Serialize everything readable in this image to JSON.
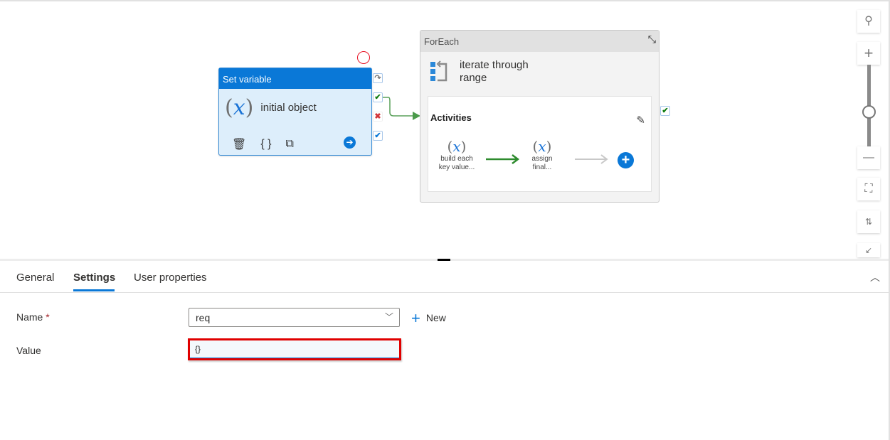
{
  "canvas": {
    "set_variable": {
      "type_label": "Set variable",
      "name": "initial object",
      "actions": [
        "delete-icon",
        "code-icon",
        "copy-icon"
      ],
      "go_icon": "arrow-right-icon"
    },
    "ports": [
      "skip",
      "success",
      "failure",
      "completion"
    ],
    "foreach": {
      "type_label": "ForEach",
      "name_line1": "iterate through",
      "name_line2": "range",
      "activities_label": "Activities",
      "inner": [
        {
          "line1": "build each",
          "line2": "key value..."
        },
        {
          "line1": "assign",
          "line2": "final..."
        }
      ]
    },
    "zoom_level": 0.5
  },
  "panel": {
    "tabs": [
      "General",
      "Settings",
      "User properties"
    ],
    "active_tab": "Settings",
    "name_label": "Name",
    "required_mark": "*",
    "name_value": "req",
    "new_label": "New",
    "value_label": "Value",
    "value_value": "{}"
  },
  "colors": {
    "accent": "#0a78d7",
    "highlight": "#e00000",
    "success": "#107c10",
    "failure": "#d13438"
  }
}
